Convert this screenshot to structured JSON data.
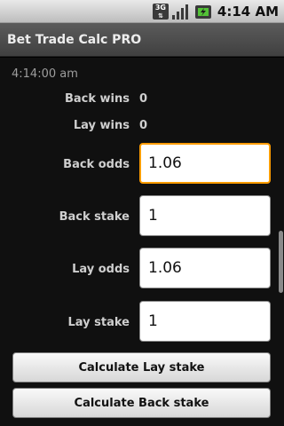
{
  "status_bar": {
    "network_type": "3G",
    "signal_icon": "signal-bars-icon",
    "battery_icon": "battery-charging-icon",
    "time": "4:14 AM"
  },
  "app": {
    "title": "Bet Trade Calc PRO"
  },
  "main": {
    "timestamp": "4:14:00 am",
    "back_wins": {
      "label": "Back wins",
      "value": "0"
    },
    "lay_wins": {
      "label": "Lay wins",
      "value": "0"
    },
    "back_odds": {
      "label": "Back odds",
      "value": "1.06"
    },
    "back_stake": {
      "label": "Back stake",
      "value": "1"
    },
    "lay_odds": {
      "label": "Lay odds",
      "value": "1.06"
    },
    "lay_stake": {
      "label": "Lay stake",
      "value": "1"
    }
  },
  "actions": {
    "calc_lay_label": "Calculate Lay stake",
    "calc_back_label": "Calculate Back stake"
  },
  "colors": {
    "focus_border": "#ff9c00",
    "background": "#101010",
    "title_bar": "#4a4a4a"
  }
}
